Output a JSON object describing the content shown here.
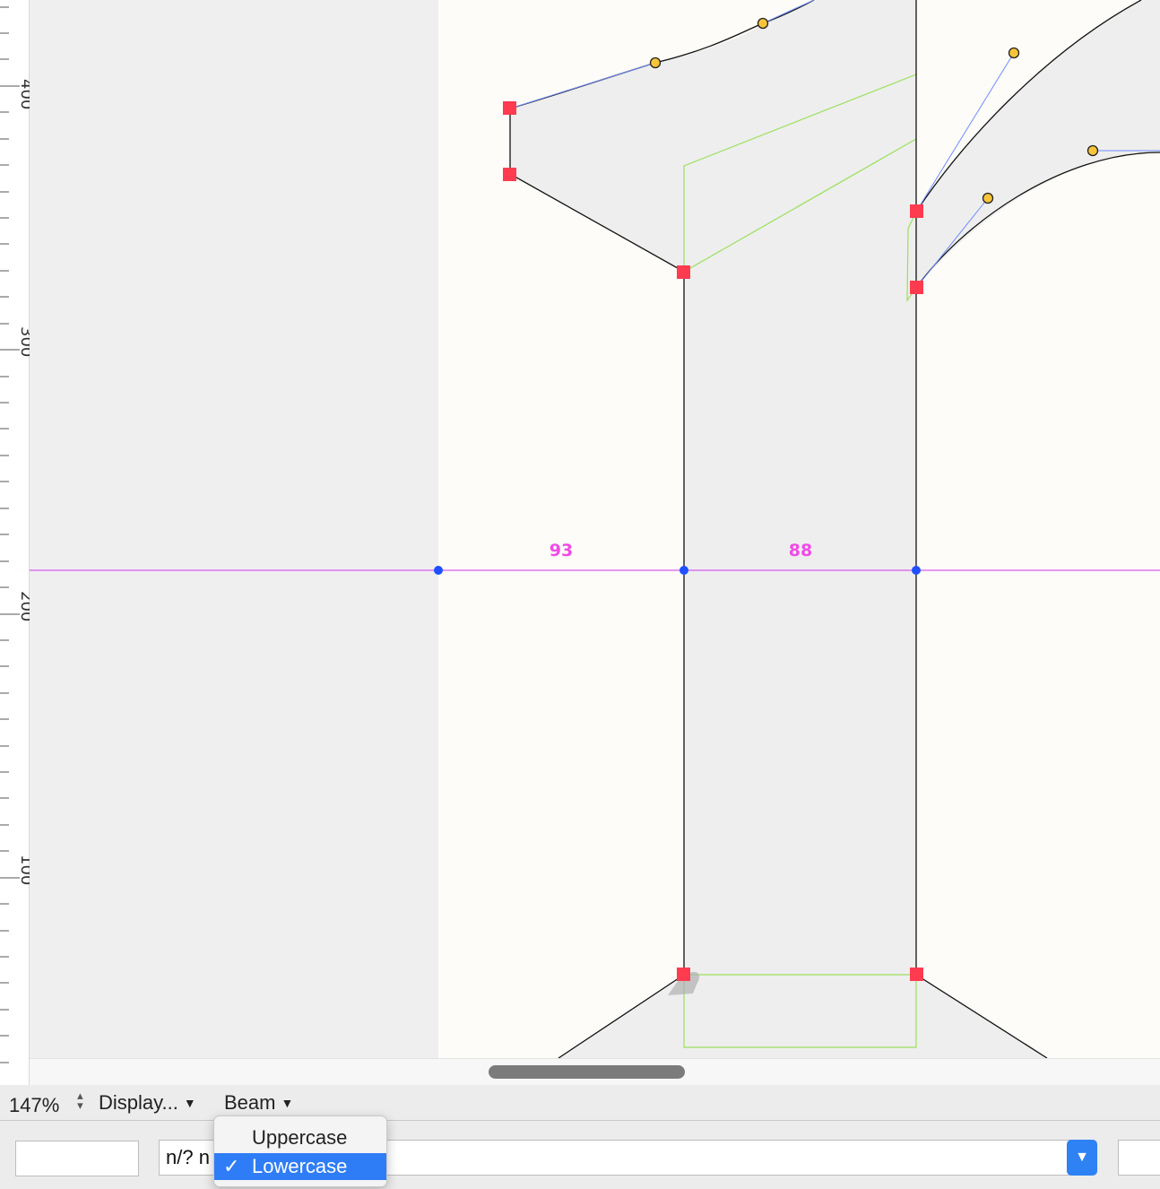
{
  "ruler": {
    "ticks": [
      "400",
      "300",
      "200",
      "100"
    ]
  },
  "canvas": {
    "measurements": [
      "93",
      "88"
    ],
    "colors": {
      "background_outside": "#efefef",
      "glyph_area": "#fdfcf8",
      "glyph_fill": "#eeeeee",
      "on_curve_point": "#ff3b4f",
      "off_curve_point": "#f7c43a",
      "handle_line": "#6f8cff",
      "measure_line": "#d55cf0",
      "measure_point": "#1f4fff",
      "measure_label": "#f24ae8",
      "guide_outline": "#9be05a"
    }
  },
  "status_bar": {
    "zoom": "147%",
    "display_label": "Display...",
    "tool_label": "Beam"
  },
  "bottom": {
    "field_left": "",
    "text_field": "n/? n",
    "field_right": ""
  },
  "popup_menu": {
    "items": [
      {
        "label": "Uppercase",
        "checked": false
      },
      {
        "label": "Lowercase",
        "checked": true
      }
    ],
    "check_mark": "✓"
  }
}
